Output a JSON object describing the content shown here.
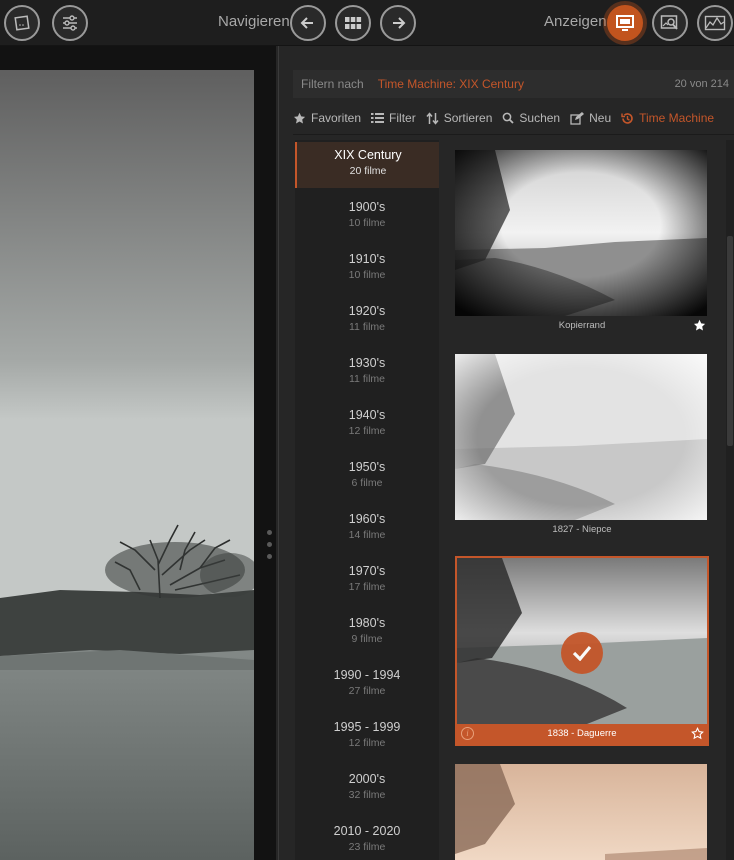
{
  "toolbar": {
    "navigate_label": "Navigieren",
    "view_label": "Anzeigen",
    "icons": [
      "crop-icon",
      "sliders-icon",
      "arrow-left-icon",
      "grid-icon",
      "arrow-right-icon",
      "monitor-icon",
      "image-search-icon",
      "histogram-icon"
    ],
    "accent": "#c4562a"
  },
  "filter": {
    "label": "Filtern nach",
    "value": "Time Machine: XIX Century",
    "count": "20 von 214"
  },
  "tabs": [
    {
      "label": "Favoriten",
      "icon": "star-icon"
    },
    {
      "label": "Filter",
      "icon": "list-icon"
    },
    {
      "label": "Sortieren",
      "icon": "sort-icon"
    },
    {
      "label": "Suchen",
      "icon": "search-icon"
    },
    {
      "label": "Neu",
      "icon": "edit-icon"
    },
    {
      "label": "Time Machine",
      "icon": "time-machine-icon"
    }
  ],
  "eras": [
    {
      "name": "XIX Century",
      "count": "20 filme"
    },
    {
      "name": "1900's",
      "count": "10 filme"
    },
    {
      "name": "1910's",
      "count": "10 filme"
    },
    {
      "name": "1920's",
      "count": "11 filme"
    },
    {
      "name": "1930's",
      "count": "11 filme"
    },
    {
      "name": "1940's",
      "count": "12 filme"
    },
    {
      "name": "1950's",
      "count": "6 filme"
    },
    {
      "name": "1960's",
      "count": "14 filme"
    },
    {
      "name": "1970's",
      "count": "17 filme"
    },
    {
      "name": "1980's",
      "count": "9 filme"
    },
    {
      "name": "1990 - 1994",
      "count": "27 filme"
    },
    {
      "name": "1995 - 1999",
      "count": "12 filme"
    },
    {
      "name": "2000's",
      "count": "32 filme"
    },
    {
      "name": "2010 - 2020",
      "count": "23 filme"
    }
  ],
  "thumbnails": [
    {
      "caption": "Kopierrand"
    },
    {
      "caption": "1827 - Niepce"
    },
    {
      "caption": "1838 - Daguerre"
    }
  ]
}
